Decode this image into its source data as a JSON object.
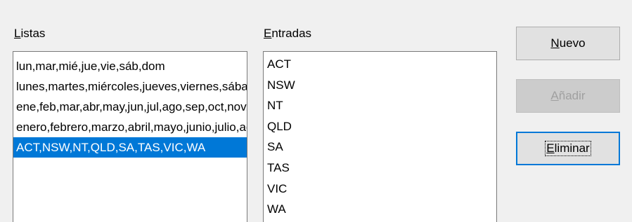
{
  "lists": {
    "label_first": "L",
    "label_rest": "istas",
    "items": [
      "lun,mar,mié,jue,vie,sáb,dom",
      "lunes,martes,miércoles,jueves,viernes,sábado,domingo",
      "ene,feb,mar,abr,may,jun,jul,ago,sep,oct,nov,dic",
      "enero,febrero,marzo,abril,mayo,junio,julio,agosto,septiembre,octubre,noviembre,diciembre",
      "ACT,NSW,NT,QLD,SA,TAS,VIC,WA"
    ],
    "selected_index": 4
  },
  "entries": {
    "label_first": "E",
    "label_rest": "ntradas",
    "items": [
      "ACT",
      "NSW",
      "NT",
      "QLD",
      "SA",
      "TAS",
      "VIC",
      "WA"
    ]
  },
  "buttons": {
    "new": {
      "accel": "N",
      "rest": "uevo",
      "enabled": true
    },
    "add": {
      "accel": "A",
      "rest": "ñadir",
      "enabled": false
    },
    "delete": {
      "accel": "E",
      "rest": "liminar",
      "enabled": true,
      "focused": true
    }
  },
  "colors": {
    "selection": "#0078d7",
    "dialog_bg": "#f0f0f0"
  }
}
